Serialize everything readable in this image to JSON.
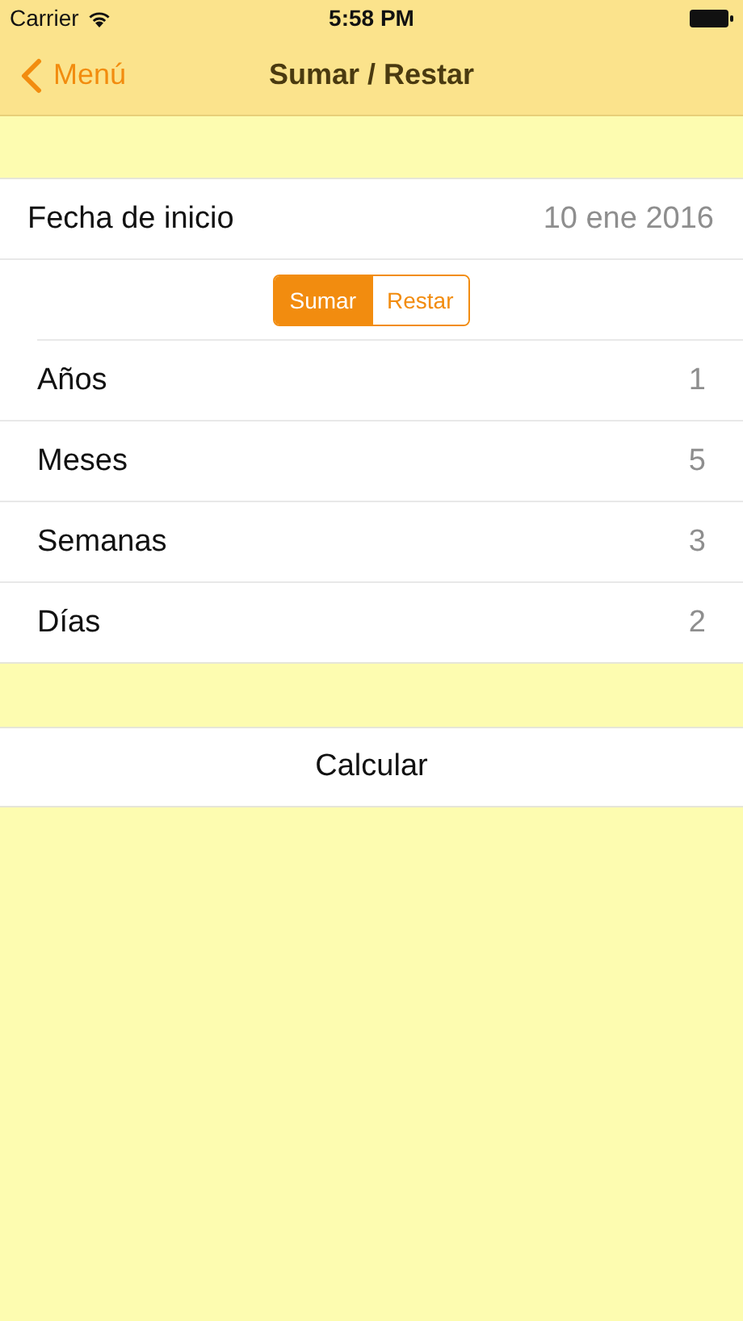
{
  "status_bar": {
    "carrier": "Carrier",
    "time": "5:58 PM"
  },
  "nav_bar": {
    "back": "Menú",
    "title": "Sumar / Restar"
  },
  "start_date": {
    "label": "Fecha de inicio",
    "value": "10 ene 2016"
  },
  "segments": [
    {
      "label": "Sumar",
      "selected": true
    },
    {
      "label": "Restar",
      "selected": false
    }
  ],
  "rows": [
    {
      "label": "Años",
      "value": "1"
    },
    {
      "label": "Meses",
      "value": "5"
    },
    {
      "label": "Semanas",
      "value": "3"
    },
    {
      "label": "Días",
      "value": "2"
    }
  ],
  "calculate_button": "Calcular"
}
